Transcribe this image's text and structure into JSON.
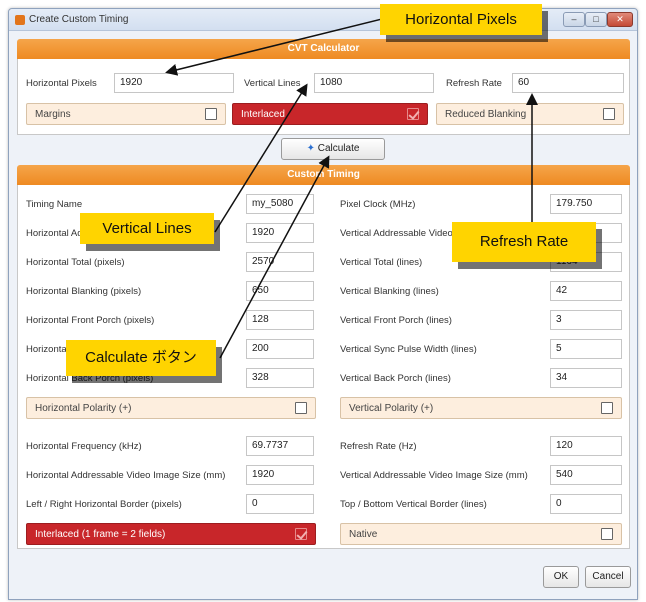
{
  "window": {
    "title": "Create Custom Timing",
    "min_label": "–",
    "max_label": "□",
    "close_label": "✕"
  },
  "cvt": {
    "header": "CVT Calculator",
    "horizontal_pixels_label": "Horizontal Pixels",
    "horizontal_pixels_value": "1920",
    "vertical_lines_label": "Vertical Lines",
    "vertical_lines_value": "1080",
    "refresh_rate_label": "Refresh Rate",
    "refresh_rate_value": "60",
    "margins_label": "Margins",
    "interlaced_label": "Interlaced",
    "reduced_blanking_label": "Reduced Blanking",
    "calculate_label": "Calculate"
  },
  "custom": {
    "header": "Custom Timing",
    "left": [
      {
        "label": "Timing Name",
        "value": "my_5080"
      },
      {
        "label": "Horizontal Addressable",
        "value": "1920"
      },
      {
        "label": "Horizontal Total (pixels)",
        "value": "2570"
      },
      {
        "label": "Horizontal Blanking (pixels)",
        "value": "650"
      },
      {
        "label": "Horizontal Front Porch (pixels)",
        "value": "128"
      },
      {
        "label": "Horizontal Sync Pulse Width",
        "value": "200"
      },
      {
        "label": "Horizontal Back Porch (pixels)",
        "value": "328"
      }
    ],
    "right": [
      {
        "label": "Pixel Clock (MHz)",
        "value": "179.750"
      },
      {
        "label": "Vertical Addressable Video",
        "value": "1080"
      },
      {
        "label": "Vertical Total (lines)",
        "value": "1164"
      },
      {
        "label": "Vertical Blanking (lines)",
        "value": "42"
      },
      {
        "label": "Vertical Front Porch (lines)",
        "value": "3"
      },
      {
        "label": "Vertical Sync Pulse Width (lines)",
        "value": "5"
      },
      {
        "label": "Vertical Back Porch (lines)",
        "value": "34"
      }
    ],
    "horizontal_polarity_label": "Horizontal Polarity (+)",
    "vertical_polarity_label": "Vertical Polarity (+)",
    "left_bottom": [
      {
        "label": "Horizontal Frequency (kHz)",
        "value": "69.7737"
      },
      {
        "label": "Horizontal Addressable Video Image Size (mm)",
        "value": "1920"
      },
      {
        "label": "Left / Right Horizontal Border (pixels)",
        "value": "0"
      }
    ],
    "right_bottom": [
      {
        "label": "Refresh Rate (Hz)",
        "value": "120"
      },
      {
        "label": "Vertical Addressable Video Image Size (mm)",
        "value": "540"
      },
      {
        "label": "Top / Bottom Vertical Border (lines)",
        "value": "0"
      }
    ],
    "interlaced_fields_label": "Interlaced (1 frame = 2 fields)",
    "native_label": "Native"
  },
  "footer": {
    "ok_label": "OK",
    "cancel_label": "Cancel"
  },
  "callouts": {
    "horizontal_pixels": "Horizontal Pixels",
    "vertical_lines": "Vertical Lines",
    "refresh_rate": "Refresh Rate",
    "calculate_button": "Calculate ボタン"
  },
  "colors": {
    "accent_orange": "#ee8a22",
    "active_red": "#c8262a",
    "callout_yellow": "#ffd400"
  }
}
